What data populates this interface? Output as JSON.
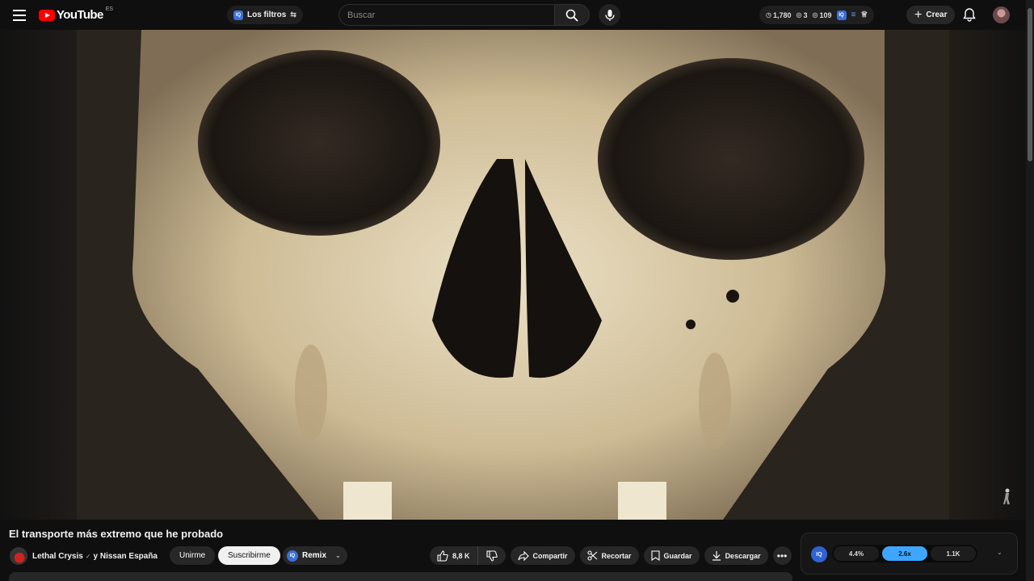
{
  "header": {
    "logo_text": "YouTube",
    "country": "ES",
    "filters_label": "Los filtros",
    "iq_badge": "IQ",
    "search_placeholder": "Buscar",
    "stats": [
      "1,780",
      "3",
      "109"
    ],
    "create_label": "Crear"
  },
  "video": {
    "title": "El transporte más extremo que he probado"
  },
  "channel": {
    "name": "Lethal Crysis",
    "verified_icon": "✓",
    "collab": "y Nissan España",
    "join_label": "Unirme",
    "subscribe_label": "Suscribirme",
    "remix_label": "Remix"
  },
  "actions": {
    "likes": "8,8 K",
    "share": "Compartir",
    "clip": "Recortar",
    "save": "Guardar",
    "download": "Descargar",
    "more": "•••"
  },
  "iq_panel": {
    "logo": "IQ",
    "metrics": [
      "4.4%",
      "2.6x",
      "1.1K"
    ],
    "active_metric": "2.6x",
    "accent": "#3ea6ff"
  },
  "icons": {
    "menu": "menu-icon",
    "search": "search-icon",
    "mic": "microphone-icon",
    "bell": "bell-icon",
    "like": "thumbs-up-icon",
    "dislike": "thumbs-down-icon",
    "share": "share-icon",
    "clip": "scissors-icon",
    "save": "bookmark-icon",
    "download": "download-icon"
  }
}
